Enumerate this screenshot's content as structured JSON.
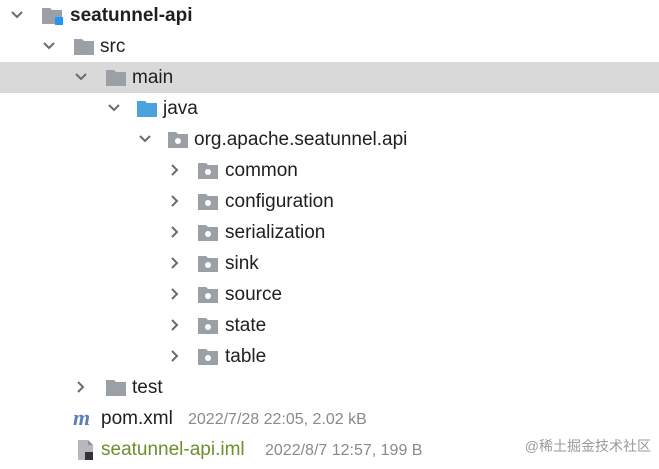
{
  "tree": {
    "project": {
      "label": "seatunnel-api"
    },
    "src": {
      "label": "src"
    },
    "main": {
      "label": "main"
    },
    "java": {
      "label": "java"
    },
    "package": {
      "label": "org.apache.seatunnel.api"
    },
    "subpackages": [
      {
        "label": "common"
      },
      {
        "label": "configuration"
      },
      {
        "label": "serialization"
      },
      {
        "label": "sink"
      },
      {
        "label": "source"
      },
      {
        "label": "state"
      },
      {
        "label": "table"
      }
    ],
    "test": {
      "label": "test"
    },
    "files": [
      {
        "label": "pom.xml",
        "meta": "2022/7/28 22:05, 2.02 kB",
        "icon": "maven-m-icon"
      },
      {
        "label": "seatunnel-api.iml",
        "meta": "2022/8/7 12:57, 199 B",
        "icon": "iml-file-icon"
      }
    ]
  },
  "colors": {
    "selected_row": "#d9d9d9",
    "folder_gray": "#9aa0a6",
    "source_folder_blue": "#4aa3df",
    "maven_m": "#5b7fb8",
    "iml_text": "#6e8e2c",
    "module_badge": "#2196f3"
  },
  "watermark": "@稀土掘金技术社区"
}
